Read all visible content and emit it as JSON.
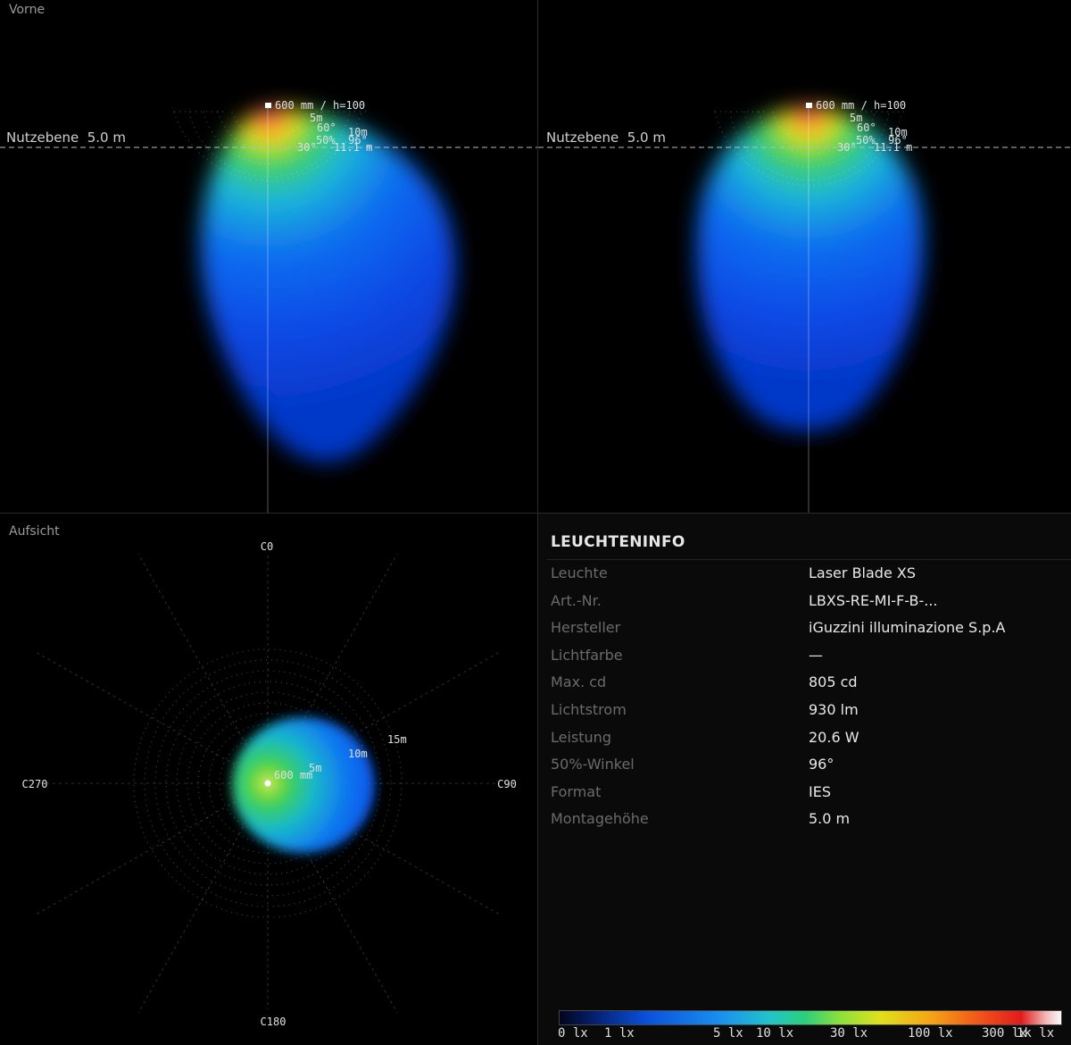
{
  "panels": {
    "front": {
      "title": "Vorne"
    },
    "top": {
      "title": "Aufsicht"
    }
  },
  "side_view": {
    "work_plane_label": "Nutzebene  5.0 m",
    "source_label": "600 mm / h=100",
    "ring_labels": [
      "5m",
      "10m",
      "60°",
      "50%  96°",
      "30°",
      "11.1 m"
    ]
  },
  "top_view": {
    "direction_labels": [
      "C0",
      "C90",
      "C180",
      "C270"
    ],
    "ring_labels": [
      "5m",
      "10m",
      "15m"
    ],
    "source_label": "600 mm"
  },
  "info": {
    "title": "LEUCHTENINFO",
    "rows": [
      {
        "key": "Leuchte",
        "value": "Laser Blade XS"
      },
      {
        "key": "Art.-Nr.",
        "value": "LBXS-RE-MI-F-B-..."
      },
      {
        "key": "Hersteller",
        "value": "iGuzzini illuminazione S.p.A"
      },
      {
        "key": "Lichtfarbe",
        "value": "—"
      },
      {
        "key": "Max. cd",
        "value": "805 cd"
      },
      {
        "key": "Lichtstrom",
        "value": "930 lm"
      },
      {
        "key": "Leistung",
        "value": "20.6 W"
      },
      {
        "key": "50%-Winkel",
        "value": "96°"
      },
      {
        "key": "Format",
        "value": "IES"
      },
      {
        "key": "Montagehöhe",
        "value": "5.0 m"
      }
    ]
  },
  "legend": {
    "ticks": [
      "0 lx",
      "1 lx",
      "5 lx",
      "10 lx",
      "30 lx",
      "100 lx",
      "300 lx",
      "1k lx"
    ]
  },
  "colors": {
    "background": "#000000",
    "divider": "#2a2a2a",
    "label_muted": "#6b6b6b",
    "value": "#e8e8e8"
  }
}
